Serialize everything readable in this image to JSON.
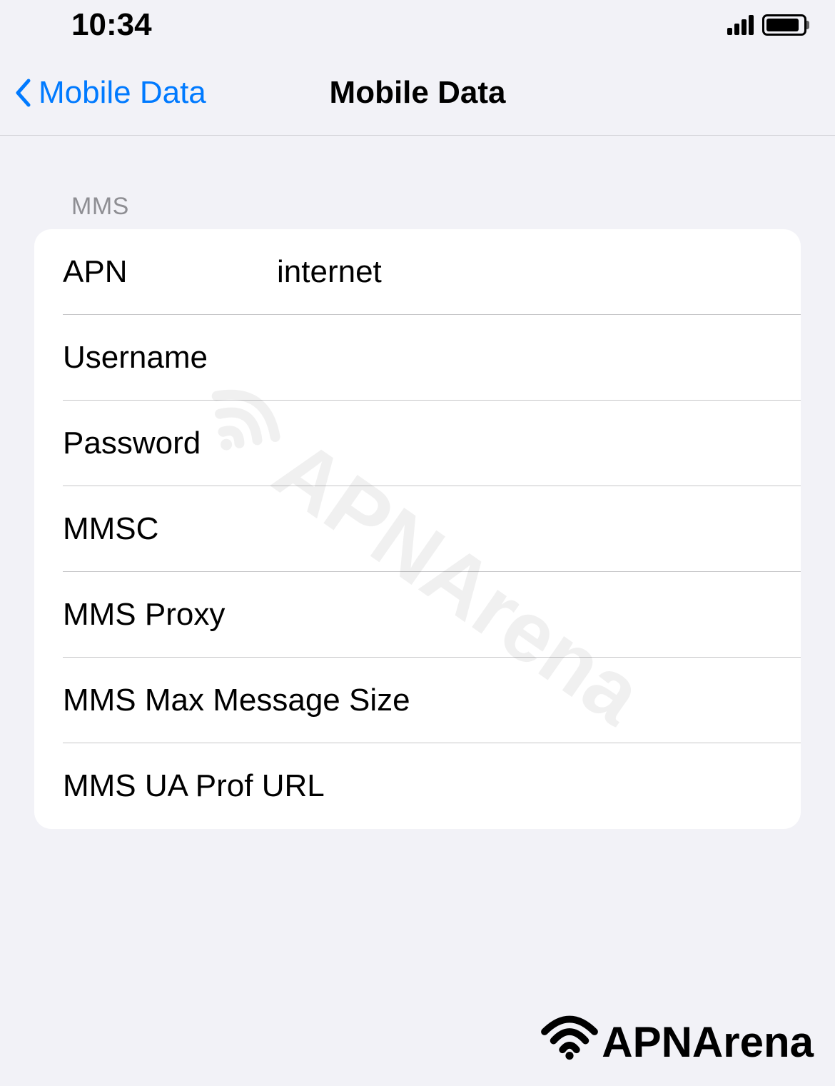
{
  "status_bar": {
    "time": "10:34"
  },
  "nav": {
    "back_label": "Mobile Data",
    "title": "Mobile Data"
  },
  "section": {
    "header": "MMS",
    "rows": [
      {
        "label": "APN",
        "value": "internet"
      },
      {
        "label": "Username",
        "value": ""
      },
      {
        "label": "Password",
        "value": ""
      },
      {
        "label": "MMSC",
        "value": ""
      },
      {
        "label": "MMS Proxy",
        "value": ""
      },
      {
        "label": "MMS Max Message Size",
        "value": ""
      },
      {
        "label": "MMS UA Prof URL",
        "value": ""
      }
    ]
  },
  "watermark": "APNArena",
  "brand": "APNArena"
}
